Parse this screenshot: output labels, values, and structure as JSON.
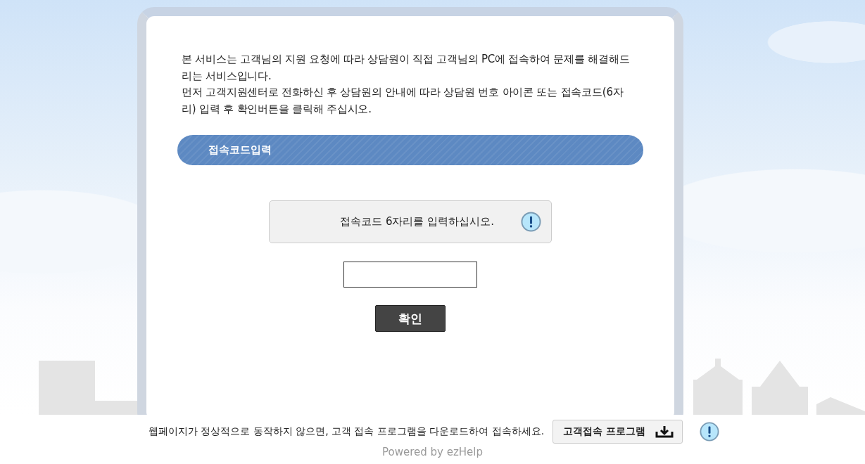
{
  "intro": [
    "본 서비스는 고객님의 지원 요청에 따라 상담원이 직접 고객님의 PC에 접속하여 문제를 해결해드리는 서비스입니다.",
    "먼저 고객지원센터로 전화하신 후 상담원의 안내에 따라 상담원 번호 아이콘 또는 접속코드(6자리) 입력 후 확인버튼을 클릭해 주십시오."
  ],
  "section_title": "접속코드입력",
  "notice": "접속코드 6자리를 입력하십시오.",
  "confirm_button": "확인",
  "footer": {
    "message": "웹페이지가 정상적으로 동작하지 않으면, 고객 접속 프로그램을 다운로드하여 접속하세요.",
    "download_button": "고객접속 프로그램",
    "powered_by": "Powered by ezHelp"
  }
}
